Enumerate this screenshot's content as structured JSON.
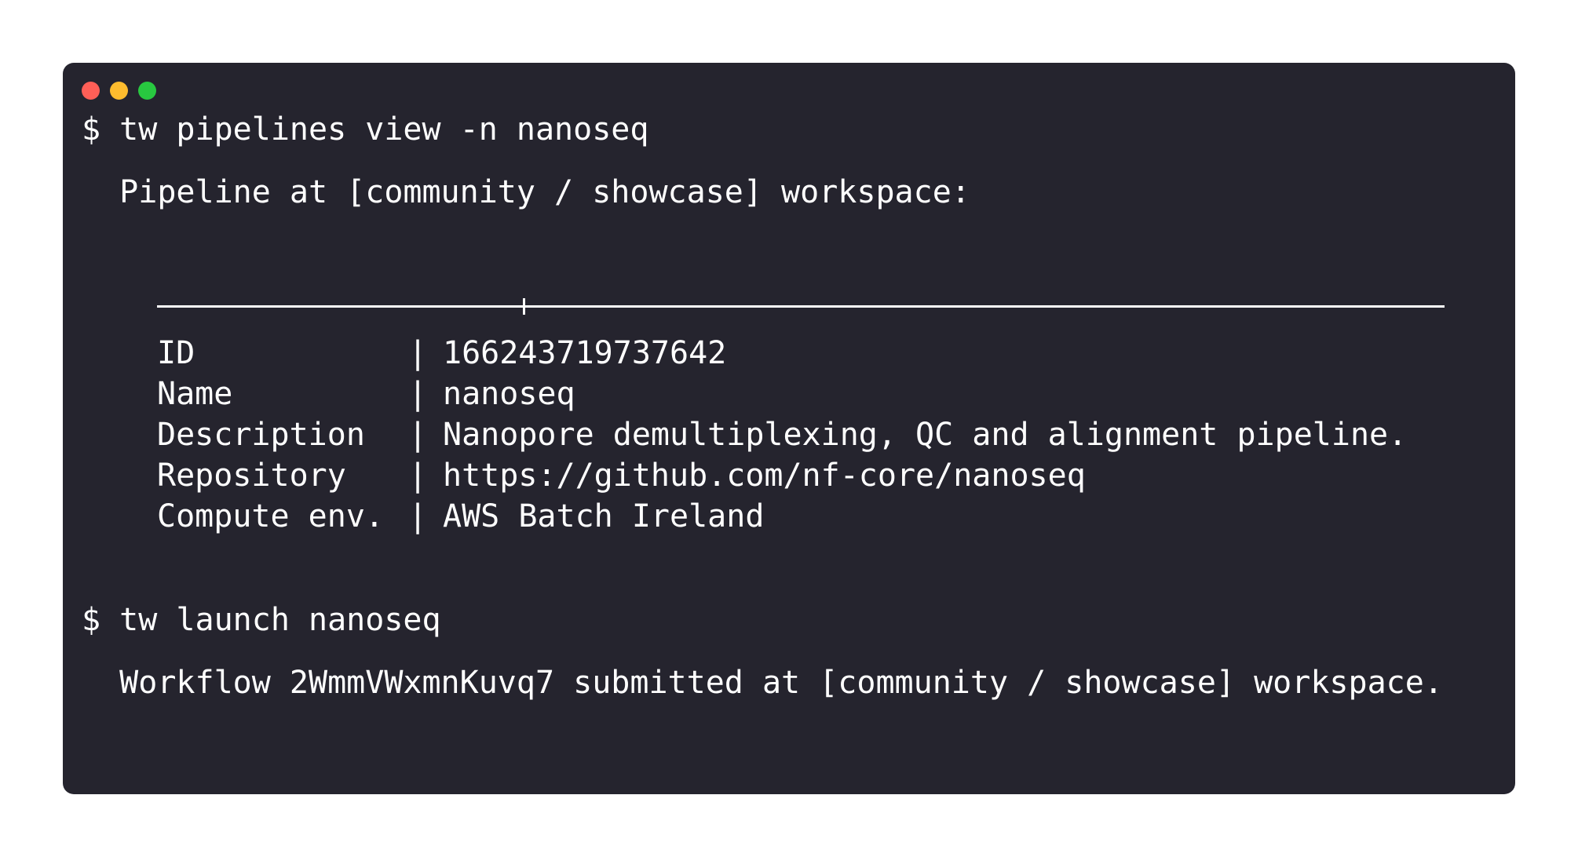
{
  "window": {
    "traffic_lights": [
      {
        "name": "close",
        "color": "#ff5f57"
      },
      {
        "name": "minimize",
        "color": "#febc2e"
      },
      {
        "name": "maximize",
        "color": "#28c840"
      }
    ]
  },
  "terminal": {
    "command_1": "$ tw pipelines view -n nanoseq",
    "header_line": "  Pipeline at [community / showcase] workspace:",
    "table": {
      "rows": [
        {
          "key": "ID",
          "sep": "|",
          "value": "166243719737642"
        },
        {
          "key": "Name",
          "sep": "|",
          "value": "nanoseq"
        },
        {
          "key": "Description",
          "sep": "|",
          "value": "Nanopore demultiplexing, QC and alignment pipeline."
        },
        {
          "key": "Repository",
          "sep": "|",
          "value": "https://github.com/nf-core/nanoseq"
        },
        {
          "key": "Compute env.",
          "sep": "|",
          "value": "AWS Batch Ireland"
        }
      ]
    },
    "command_2": "$ tw launch nanoseq",
    "result_line": "  Workflow 2WmmVWxmnKuvq7 submitted at [community / showcase] workspace."
  }
}
